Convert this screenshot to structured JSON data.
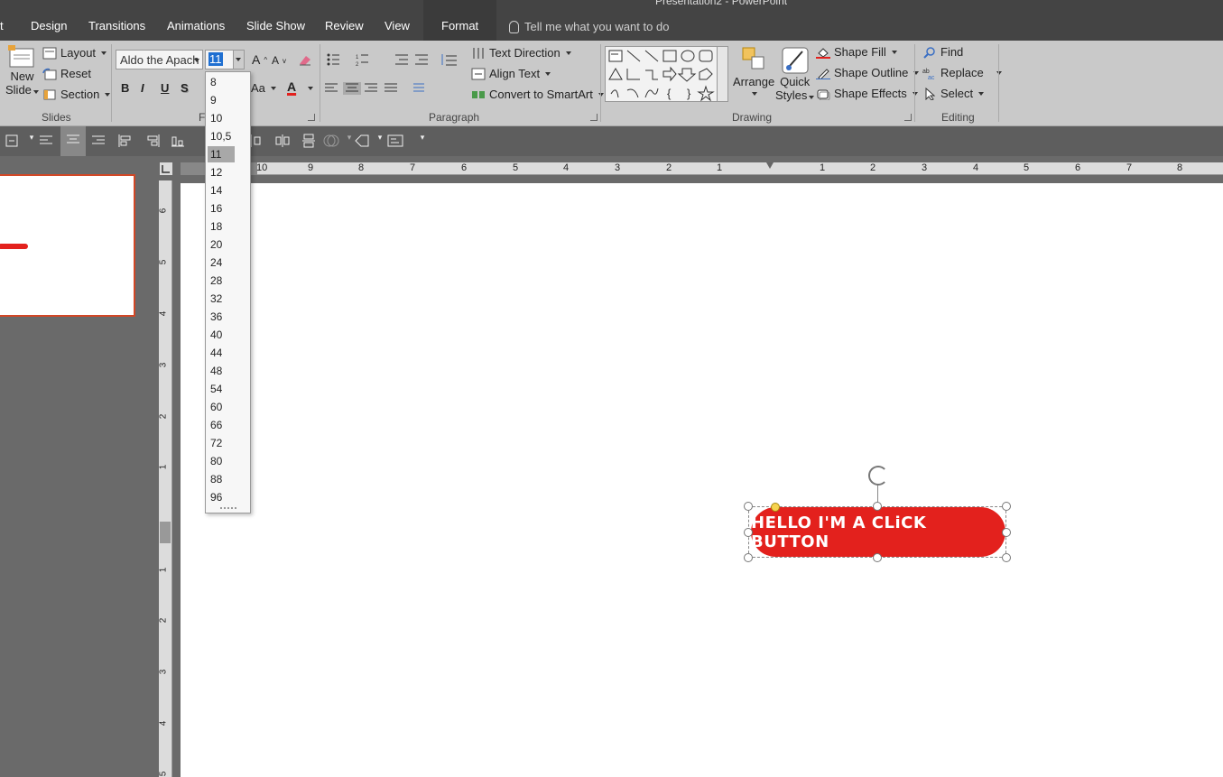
{
  "tabs": {
    "title_fragment": "Presentation2 - PowerPoint",
    "items": [
      "t",
      "Design",
      "Transitions",
      "Animations",
      "Slide Show",
      "Review",
      "View",
      "Format"
    ],
    "tell_me": "Tell me what you want to do"
  },
  "ribbon": {
    "slides": {
      "new_slide_line1": "New",
      "new_slide_line2": "Slide",
      "layout": "Layout",
      "reset": "Reset",
      "section": "Section",
      "label": "Slides"
    },
    "font": {
      "name_value": "Aldo the Apach",
      "size_value": "11",
      "label": "Fo",
      "bold": "B",
      "italic": "I",
      "underline": "U",
      "shadow": "S",
      "grow": "A",
      "shrink": "A",
      "change_case": "Aa",
      "color_letter": "A",
      "font_color": "#e3211d"
    },
    "paragraph": {
      "text_direction": "Text Direction",
      "align_text": "Align Text",
      "convert_smartart": "Convert to SmartArt",
      "label": "Paragraph"
    },
    "drawing": {
      "arrange": "Arrange",
      "quick_styles_line1": "Quick",
      "quick_styles_line2": "Styles",
      "shape_fill": "Shape Fill",
      "shape_outline": "Shape Outline",
      "shape_effects": "Shape Effects",
      "label": "Drawing"
    },
    "editing": {
      "find": "Find",
      "replace": "Replace",
      "select": "Select",
      "label": "Editing"
    }
  },
  "font_size_list": [
    "8",
    "9",
    "10",
    "10,5",
    "11",
    "12",
    "14",
    "16",
    "18",
    "20",
    "24",
    "28",
    "32",
    "36",
    "40",
    "44",
    "48",
    "54",
    "60",
    "66",
    "72",
    "80",
    "88",
    "96"
  ],
  "font_size_selected": "11",
  "ruler": {
    "h_numbers": [
      "10",
      "9",
      "8",
      "7",
      "6",
      "5",
      "4",
      "3",
      "2",
      "1",
      "1",
      "2",
      "3",
      "4",
      "5",
      "6",
      "7",
      "8"
    ],
    "v_numbers": [
      "6",
      "5",
      "4",
      "3",
      "2",
      "1",
      "1",
      "2",
      "3",
      "4",
      "5"
    ]
  },
  "slide": {
    "button_text": "HELLO I'M A CLiCK BUTTON",
    "button_color": "#e3211d"
  },
  "colors": {
    "ribbon_bg": "#c9c9c9",
    "tabs_bg": "#444444",
    "accent_thumb_border": "#d24726"
  }
}
